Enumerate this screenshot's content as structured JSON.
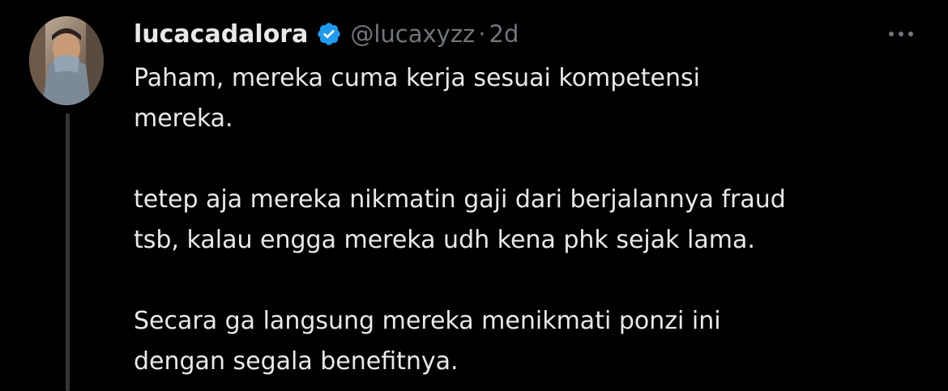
{
  "tweet": {
    "author": {
      "display_name": "lucacadalora",
      "handle": "@lucaxyzz",
      "verified": true
    },
    "separator": "·",
    "time": "2d",
    "paragraphs": [
      {
        "lines": [
          "Paham, mereka cuma kerja sesuai kompetensi",
          "mereka."
        ]
      },
      {
        "lines": [
          "tetep aja mereka nikmatin gaji dari berjalannya fraud",
          "tsb, kalau engga mereka udh kena phk sejak lama."
        ]
      },
      {
        "lines": [
          "Secara ga langsung mereka menikmati ponzi ini",
          "dengan segala benefitnya."
        ]
      }
    ]
  },
  "icons": {
    "verified": "verified-badge-icon",
    "more": "more-options-icon",
    "avatar": "avatar-photo"
  },
  "colors": {
    "background": "#000000",
    "text_primary": "#e7e9ea",
    "text_secondary": "#71767b",
    "verified_blue": "#1d9bf0",
    "thread_line": "#333639"
  }
}
